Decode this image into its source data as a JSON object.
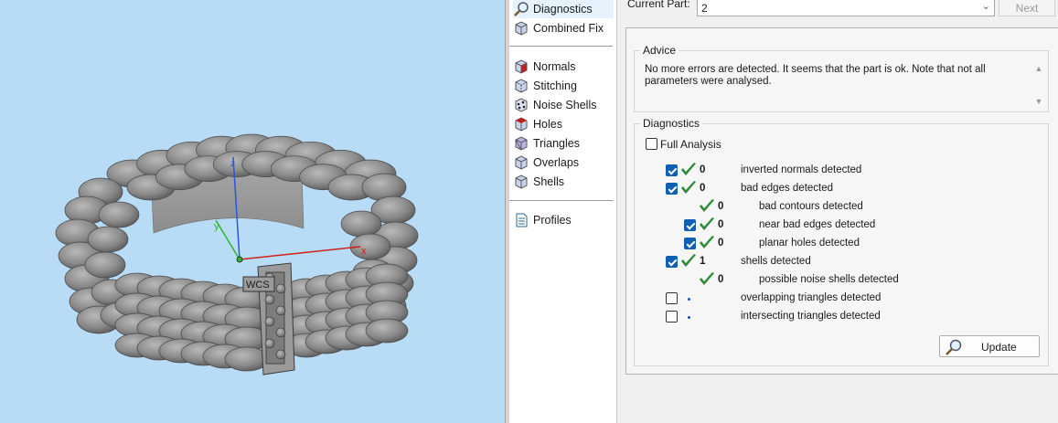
{
  "viewport": {
    "wcs_label": "WCS",
    "axes": {
      "x": "x",
      "y": "y",
      "z": "z"
    }
  },
  "menu": {
    "items": [
      {
        "label": "Diagnostics",
        "icon": "magnifier-icon",
        "selected": true
      },
      {
        "label": "Combined Fix",
        "icon": "cube-icon"
      },
      {
        "label": "Normals",
        "icon": "normals-cube-icon"
      },
      {
        "label": "Stitching",
        "icon": "stitching-cube-icon"
      },
      {
        "label": "Noise Shells",
        "icon": "noise-shells-icon"
      },
      {
        "label": "Holes",
        "icon": "holes-cube-icon"
      },
      {
        "label": "Triangles",
        "icon": "triangles-cube-icon"
      },
      {
        "label": "Overlaps",
        "icon": "overlaps-cube-icon"
      },
      {
        "label": "Shells",
        "icon": "shells-cube-icon"
      },
      {
        "label": "Profiles",
        "icon": "document-icon"
      }
    ]
  },
  "panel": {
    "current_part_label": "Current Part:",
    "current_part_value": "2",
    "next_label": "Next",
    "advice": {
      "title": "Advice",
      "text": "No more errors are detected. It seems that the part is ok. Note that not all parameters were analysed."
    },
    "diagnostics": {
      "title": "Diagnostics",
      "full_analysis_label": "Full Analysis",
      "full_analysis_checked": false,
      "rows": [
        {
          "checked": true,
          "status": "ok",
          "count": "0",
          "label": "inverted normals detected",
          "indent": 0,
          "has_checkbox": true
        },
        {
          "checked": true,
          "status": "ok",
          "count": "0",
          "label": "bad edges detected",
          "indent": 0,
          "has_checkbox": true
        },
        {
          "checked": false,
          "status": "ok",
          "count": "0",
          "label": "bad contours detected",
          "indent": 1,
          "has_checkbox": false
        },
        {
          "checked": true,
          "status": "ok",
          "count": "0",
          "label": "near bad edges detected",
          "indent": 1,
          "has_checkbox": true
        },
        {
          "checked": true,
          "status": "ok",
          "count": "0",
          "label": "planar holes detected",
          "indent": 1,
          "has_checkbox": true
        },
        {
          "checked": true,
          "status": "ok",
          "count": "1",
          "label": "shells detected",
          "indent": 0,
          "has_checkbox": true
        },
        {
          "checked": false,
          "status": "ok",
          "count": "0",
          "label": "possible noise shells detected",
          "indent": 1,
          "has_checkbox": false
        },
        {
          "checked": false,
          "status": "none",
          "count": "",
          "label": "overlapping triangles detected",
          "indent": 0,
          "has_checkbox": true
        },
        {
          "checked": false,
          "status": "none",
          "count": "",
          "label": "intersecting triangles detected",
          "indent": 0,
          "has_checkbox": true
        }
      ]
    },
    "update_label": "Update"
  },
  "colors": {
    "viewport_bg": "#b9dcf6",
    "ok_tick": "#2e8b3a",
    "checkbox_on": "#0f5fb5",
    "axis_x": "#d0201a",
    "axis_y": "#2db52d",
    "axis_z": "#2857e0"
  }
}
